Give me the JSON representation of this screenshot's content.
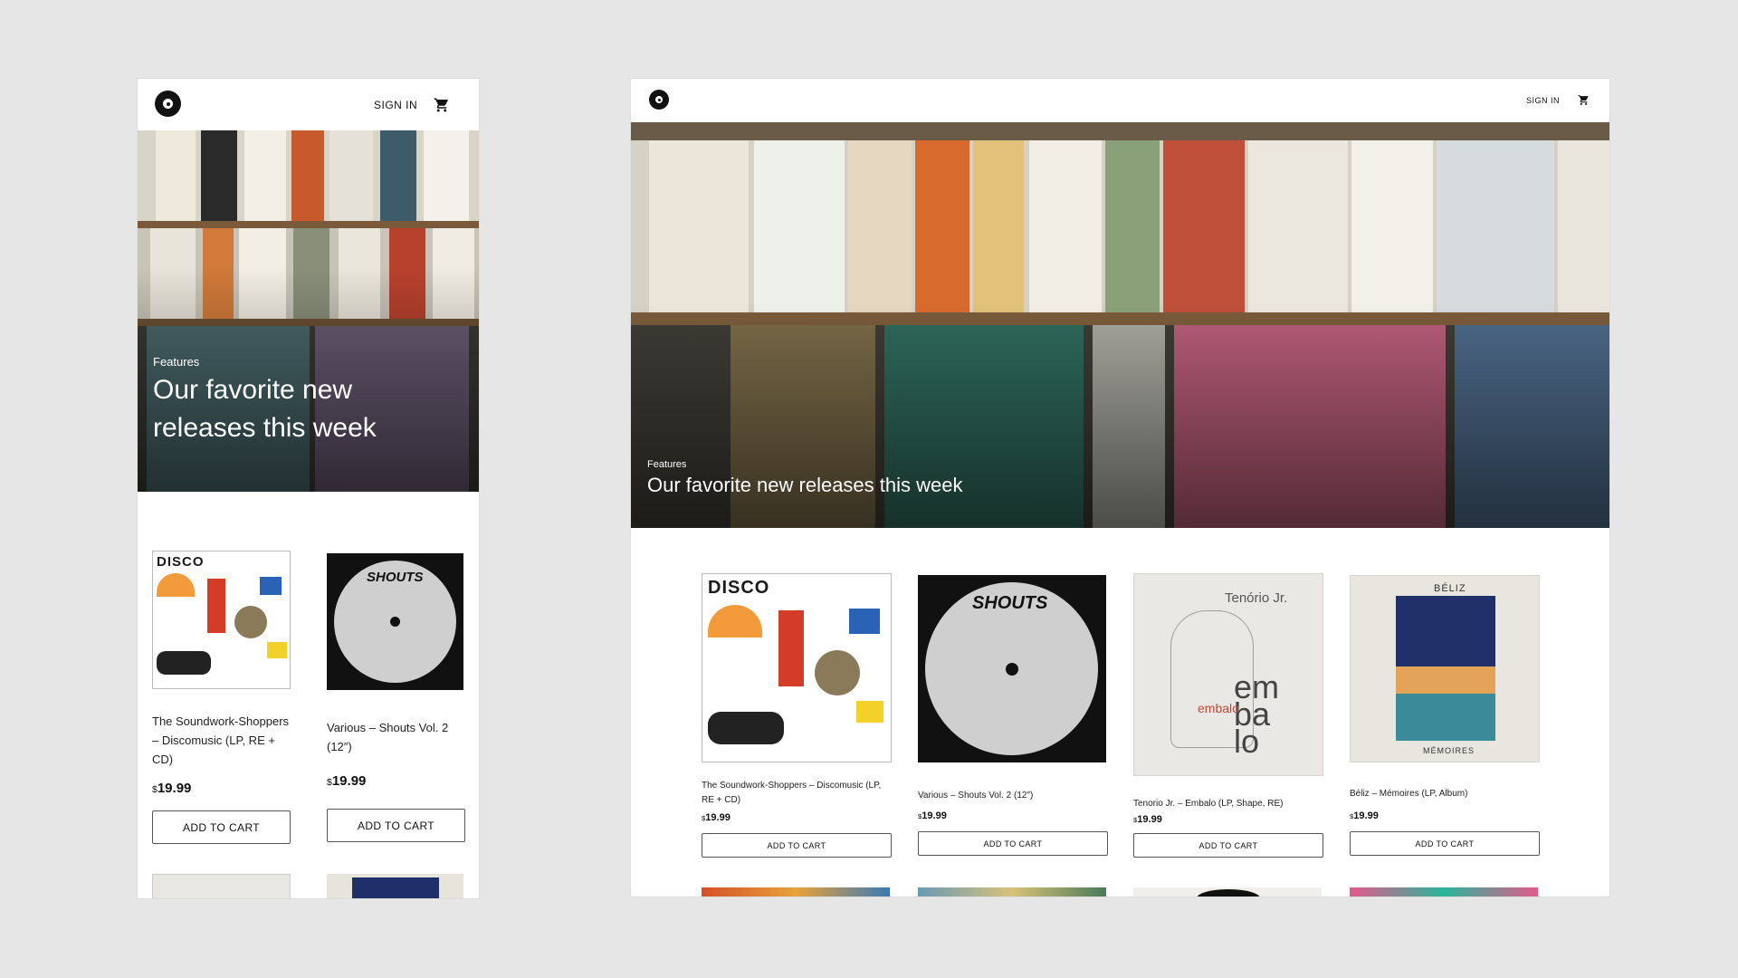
{
  "colors": {
    "background": "#e6e6e6",
    "surface": "#ffffff",
    "text": "#111111"
  },
  "header": {
    "signin_label": "SIGN IN",
    "logo_icon": "vinyl-record-logo-icon",
    "cart_icon": "shopping-cart-icon"
  },
  "hero": {
    "kicker": "Features",
    "title": "Our favorite new releases this week"
  },
  "price_currency": "$",
  "products": [
    {
      "title": "The Soundwork-Shoppers – Discomusic (LP, RE + CD)",
      "price": "19.99",
      "button": "ADD TO CART"
    },
    {
      "title": "Various – Shouts Vol. 2 (12″)",
      "price": "19.99",
      "button": "ADD TO CART"
    },
    {
      "title": "Tenorio Jr. – Embalo (LP, Shape, RE)",
      "price": "19.99",
      "button": "ADD TO CART"
    },
    {
      "title": "Béliz – Mémoires (LP, Album)",
      "price": "19.99",
      "button": "ADD TO CART"
    }
  ],
  "mobile_products": [
    {
      "title": "The Soundwork-Shoppers – Discomusic (LP, RE + CD)",
      "price": "19.99",
      "button": "ADD TO CART"
    },
    {
      "title": "Various – Shouts Vol. 2 (12″)",
      "price": "19.99",
      "button": "ADD TO CART"
    }
  ]
}
